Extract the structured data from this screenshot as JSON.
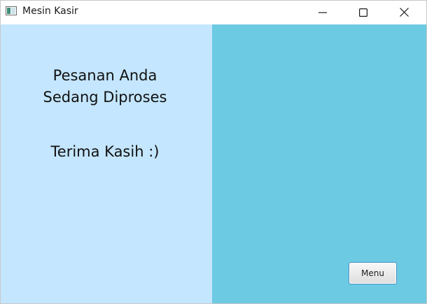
{
  "window": {
    "title": "Mesin Kasir",
    "icon": "java-app-icon",
    "controls": [
      "minimize-icon",
      "maximize-icon",
      "close-icon"
    ]
  },
  "left_panel": {
    "background": "#c4e6fe",
    "message_line1": "Pesanan Anda",
    "message_line2": "Sedang Diproses",
    "thanks": "Terima Kasih :)"
  },
  "right_panel": {
    "background": "#6ccae2",
    "menu_button_label": "Menu"
  }
}
